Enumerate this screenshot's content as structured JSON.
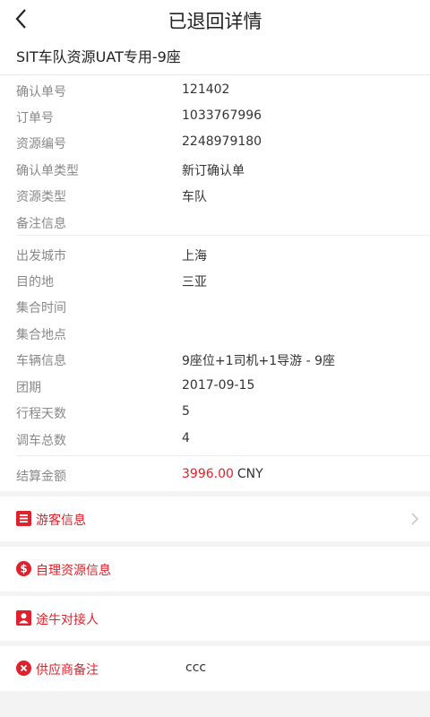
{
  "header": {
    "title": "已退回详情"
  },
  "resource_name": "SIT车队资源UAT专用-9座",
  "group1": [
    {
      "label": "确认单号",
      "value": "121402"
    },
    {
      "label": "订单号",
      "value": "1033767996"
    },
    {
      "label": "资源编号",
      "value": "2248979180"
    },
    {
      "label": "确认单类型",
      "value": "新订确认单"
    },
    {
      "label": "资源类型",
      "value": "车队"
    },
    {
      "label": "备注信息",
      "value": ""
    }
  ],
  "group2": [
    {
      "label": "出发城市",
      "value": "上海"
    },
    {
      "label": "目的地",
      "value": "三亚"
    },
    {
      "label": "集合时间",
      "value": ""
    },
    {
      "label": "集合地点",
      "value": ""
    },
    {
      "label": "车辆信息",
      "value": " 9座位+1司机+1导游 - 9座"
    },
    {
      "label": "团期",
      "value": "2017-09-15"
    },
    {
      "label": "行程天数",
      "value": "5"
    },
    {
      "label": "调车总数",
      "value": "4"
    }
  ],
  "settlement": {
    "label": "结算金额",
    "amount": "3996.00",
    "currency": "CNY"
  },
  "sections": [
    {
      "label": "游客信息",
      "icon": "list-icon"
    },
    {
      "label": "自理资源信息",
      "icon": "dollar-icon"
    },
    {
      "label": "途牛对接人",
      "icon": "person-icon"
    },
    {
      "label": "供应商备注",
      "icon": "close-circle-icon",
      "value": "ccc"
    }
  ],
  "colors": {
    "accent": "#e0202a",
    "background": "#f3f3f3",
    "label": "#888888"
  }
}
